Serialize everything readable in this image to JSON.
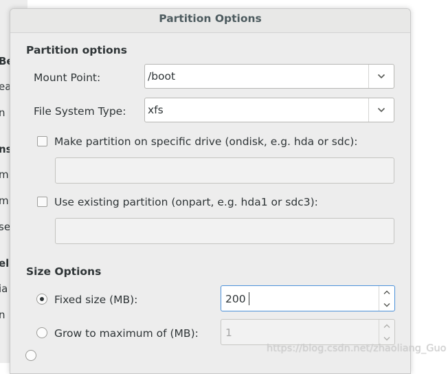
{
  "background": {
    "labels": [
      "Be",
      "ea",
      "n",
      "ns",
      "m",
      "m",
      "se",
      "el",
      "ia",
      "n"
    ]
  },
  "dialog": {
    "title": "Partition Options",
    "partition_options": {
      "heading": "Partition options",
      "mount_point": {
        "label": "Mount Point:",
        "value": "/boot"
      },
      "fs_type": {
        "label": "File System Type:",
        "value": "xfs"
      },
      "ondisk": {
        "label": "Make partition on specific drive (ondisk, e.g. hda or sdc):",
        "checked": false,
        "value": ""
      },
      "onpart": {
        "label": "Use existing partition (onpart, e.g. hda1 or sdc3):",
        "checked": false,
        "value": ""
      }
    },
    "size_options": {
      "heading": "Size Options",
      "fixed": {
        "label": "Fixed size (MB):",
        "selected": true,
        "value": "200"
      },
      "grow": {
        "label": "Grow to maximum of (MB):",
        "selected": false,
        "value": "1"
      }
    }
  },
  "watermark": "https://blog.csdn.net/zhaoliang_Guo",
  "colors": {
    "focus_border": "#4a90d9",
    "dialog_bg": "#ededed",
    "title_text": "#4d5b5f"
  },
  "icons": {
    "combo": "chevron-down-icon",
    "spin_up": "chevron-up-icon",
    "spin_down": "chevron-down-icon"
  }
}
